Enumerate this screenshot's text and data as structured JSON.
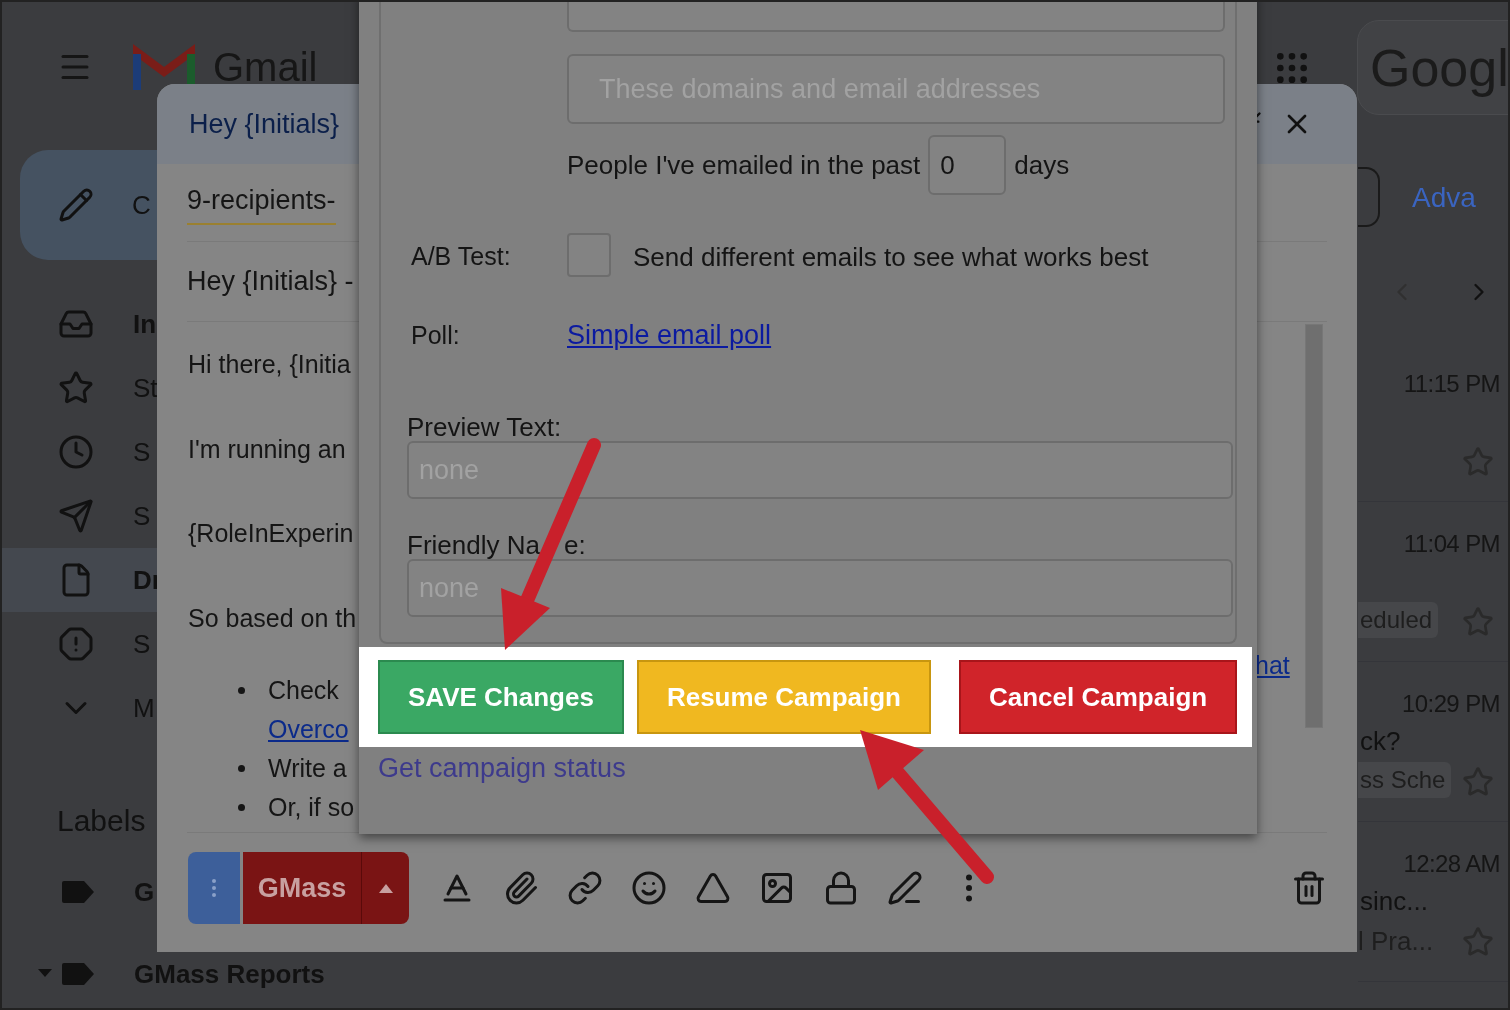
{
  "gmail": {
    "logo": "Gmail",
    "search": "Googl",
    "compose": "C",
    "nav": [
      {
        "kind": "inbox",
        "label": "In",
        "selected": false,
        "unread": true
      },
      {
        "kind": "star",
        "label": "St",
        "selected": false,
        "unread": false
      },
      {
        "kind": "snooze",
        "label": "S",
        "selected": false,
        "unread": false
      },
      {
        "kind": "sent",
        "label": "S",
        "selected": false,
        "unread": false
      },
      {
        "kind": "drafts",
        "label": "Dr",
        "selected": true,
        "unread": false
      },
      {
        "kind": "spam",
        "label": "S",
        "selected": false,
        "unread": false
      },
      {
        "kind": "more",
        "label": "M",
        "selected": false,
        "unread": false
      }
    ],
    "labels_heading": "Labels",
    "labels": [
      {
        "label": "G"
      },
      {
        "label": "GMass Reports",
        "expanded": true
      }
    ],
    "advanced": "Adva",
    "emails": [
      {
        "time": "11:15 PM",
        "starred": false
      },
      {
        "time": "11:04 PM",
        "tag": "eduled",
        "starred": false
      },
      {
        "time": "10:29 PM",
        "subject": "ck?",
        "tag": "ss Sche",
        "starred": false
      },
      {
        "time": "12:28 AM",
        "subject": "sinc...",
        "preview": "l Pra...",
        "starred": false
      }
    ]
  },
  "compose": {
    "title": "Hey {Initials}",
    "from": "9-recipients-",
    "subject": "Hey {Initials} -",
    "body": [
      "Hi there, {Initia",
      "I'm running an",
      "{RoleInExperin",
      "So based on th"
    ],
    "bullets": [
      {
        "text": "Check",
        "link": "Overco"
      },
      {
        "text": "Write a"
      },
      {
        "text": "Or, if so"
      }
    ],
    "link_fragment": "hat",
    "send_label": "GMass"
  },
  "settings": {
    "domains": {
      "placeholder": "These domains and email addresses"
    },
    "past": {
      "label": "People I've emailed in the past",
      "value": "0",
      "unit": "days"
    },
    "ab_test": {
      "label": "A/B Test:",
      "checked": false,
      "text": "Send different emails to see what works best"
    },
    "poll": {
      "label": "Poll:",
      "link": "Simple email poll"
    },
    "preview_text": {
      "label": "Preview Text:",
      "placeholder": "none"
    },
    "friendly_name": {
      "label_parts": [
        "Friendly Na",
        "e:"
      ],
      "placeholder": "none"
    },
    "buttons": [
      {
        "kind": "save",
        "label": "SAVE Changes"
      },
      {
        "kind": "resume",
        "label": "Resume Campaign"
      },
      {
        "kind": "cancel",
        "label": "Cancel Campaign"
      }
    ],
    "status_link": "Get campaign status"
  }
}
